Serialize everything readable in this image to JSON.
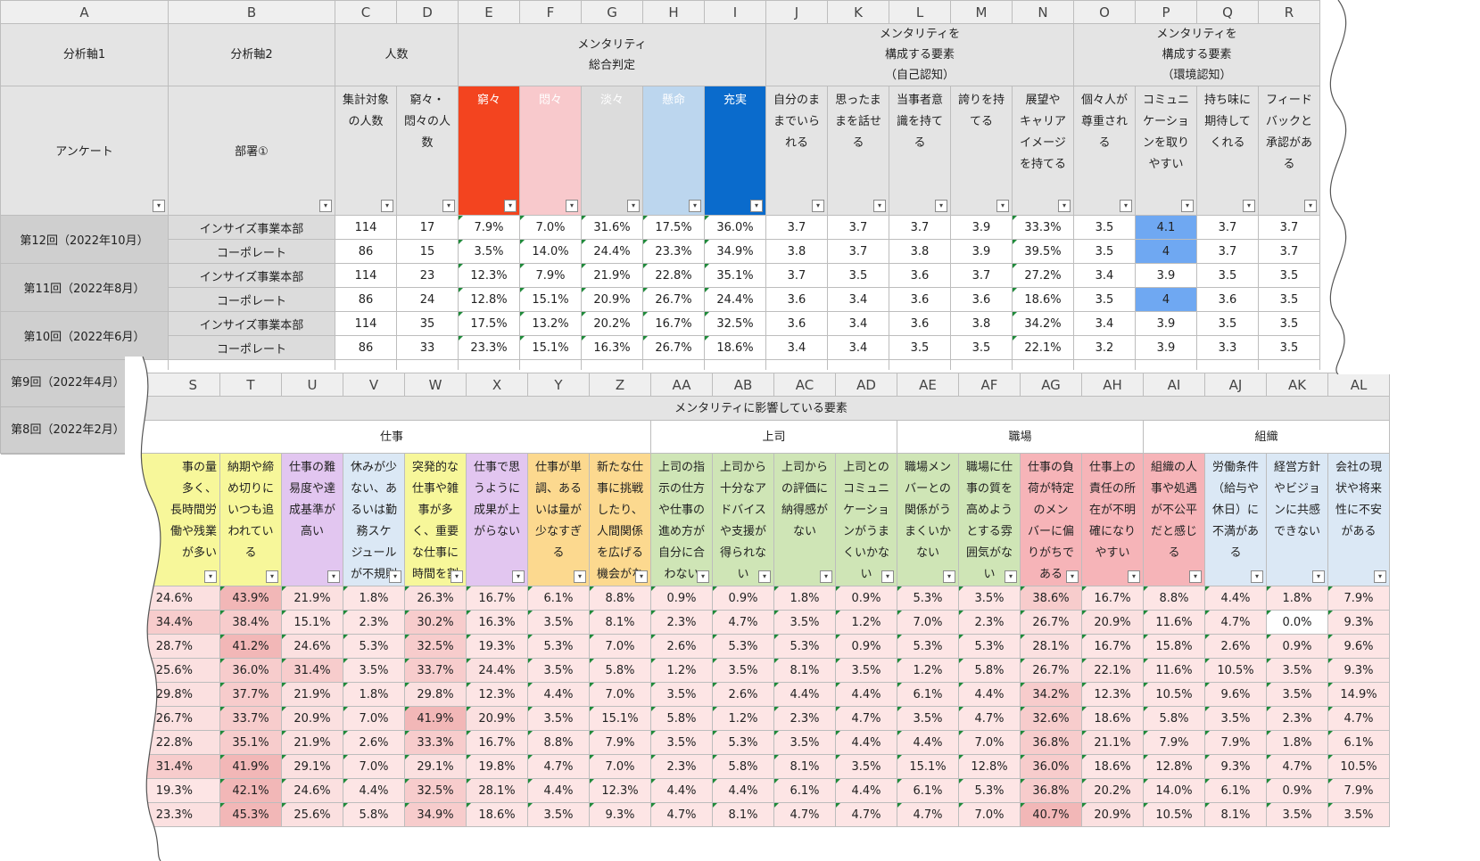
{
  "top": {
    "columns": [
      "A",
      "B",
      "C",
      "D",
      "E",
      "F",
      "G",
      "H",
      "I",
      "J",
      "K",
      "L",
      "M",
      "N",
      "O",
      "P",
      "Q",
      "R"
    ],
    "axis1_header": "分析軸1",
    "axis2_header": "分析軸2",
    "count_header": "人数",
    "mentality_header": "メンタリティ\n総合判定",
    "self_header": "メンタリティを\n構成する要素\n（自己認知）",
    "env_header": "メンタリティを\n構成する要素\n（環境認知）",
    "row_label_a": "アンケート",
    "row_label_b": "部署①",
    "questions": [
      {
        "text": "集計対象\nの人数",
        "bg": "#e4e4e4",
        "fg": "#222"
      },
      {
        "text": "窮々・\n悶々の人\n数",
        "bg": "#e4e4e4",
        "fg": "#222"
      },
      {
        "text": "窮々",
        "bg": "#f3441f",
        "fg": "#ffffff"
      },
      {
        "text": "悶々",
        "bg": "#f8c9cc",
        "fg": "#ffffff"
      },
      {
        "text": "淡々",
        "bg": "#dcdcdc",
        "fg": "#ffffff"
      },
      {
        "text": "懸命",
        "bg": "#bcd6ee",
        "fg": "#ffffff"
      },
      {
        "text": "充実",
        "bg": "#0a6bcc",
        "fg": "#ffffff"
      },
      {
        "text": "自分のま\nまでいら\nれる",
        "bg": "#e4e4e4",
        "fg": "#222"
      },
      {
        "text": "思ったま\nまを話せ\nる",
        "bg": "#e4e4e4",
        "fg": "#222"
      },
      {
        "text": "当事者意\n識を持て\nる",
        "bg": "#e4e4e4",
        "fg": "#222"
      },
      {
        "text": "誇りを持\nてる",
        "bg": "#e4e4e4",
        "fg": "#222"
      },
      {
        "text": "展望や\nキャリア\nイメージ\nを持てる",
        "bg": "#e4e4e4",
        "fg": "#222"
      },
      {
        "text": "個々人が\n尊重され\nる",
        "bg": "#e4e4e4",
        "fg": "#222"
      },
      {
        "text": "コミュニ\nケーショ\nンを取り\nやすい",
        "bg": "#e4e4e4",
        "fg": "#222"
      },
      {
        "text": "持ち味に\n期待して\nくれる",
        "bg": "#e4e4e4",
        "fg": "#222"
      },
      {
        "text": "フィード\nバックと\n承認があ\nる",
        "bg": "#e4e4e4",
        "fg": "#222"
      }
    ],
    "groups": [
      {
        "label": "第12回（2022年10月）",
        "rows": [
          {
            "dept": "インサイズ事業本部",
            "vals": [
              "114",
              "17",
              "7.9%",
              "7.0%",
              "31.6%",
              "17.5%",
              "36.0%",
              "3.7",
              "3.7",
              "3.7",
              "3.9",
              "33.3%",
              "3.5",
              "4.1",
              "3.7",
              "3.7"
            ]
          },
          {
            "dept": "コーポレート",
            "vals": [
              "86",
              "15",
              "3.5%",
              "14.0%",
              "24.4%",
              "23.3%",
              "34.9%",
              "3.8",
              "3.7",
              "3.8",
              "3.9",
              "39.5%",
              "3.5",
              "4",
              "3.7",
              "3.7"
            ]
          }
        ]
      },
      {
        "label": "第11回（2022年8月）",
        "rows": [
          {
            "dept": "インサイズ事業本部",
            "vals": [
              "114",
              "23",
              "12.3%",
              "7.9%",
              "21.9%",
              "22.8%",
              "35.1%",
              "3.7",
              "3.5",
              "3.6",
              "3.7",
              "27.2%",
              "3.4",
              "3.9",
              "3.5",
              "3.5"
            ]
          },
          {
            "dept": "コーポレート",
            "vals": [
              "86",
              "24",
              "12.8%",
              "15.1%",
              "20.9%",
              "26.7%",
              "24.4%",
              "3.6",
              "3.4",
              "3.6",
              "3.6",
              "18.6%",
              "3.5",
              "4",
              "3.6",
              "3.5"
            ]
          }
        ]
      },
      {
        "label": "第10回（2022年6月）",
        "rows": [
          {
            "dept": "インサイズ事業本部",
            "vals": [
              "114",
              "35",
              "17.5%",
              "13.2%",
              "20.2%",
              "16.7%",
              "32.5%",
              "3.6",
              "3.4",
              "3.6",
              "3.8",
              "34.2%",
              "3.4",
              "3.9",
              "3.5",
              "3.5"
            ]
          },
          {
            "dept": "コーポレート",
            "vals": [
              "86",
              "33",
              "23.3%",
              "15.1%",
              "16.3%",
              "26.7%",
              "18.6%",
              "3.4",
              "3.4",
              "3.5",
              "3.5",
              "22.1%",
              "3.2",
              "3.9",
              "3.3",
              "3.5"
            ]
          }
        ]
      }
    ],
    "behind_labels": [
      "第9回（2022年4月）",
      "第8回（2022年2月）"
    ]
  },
  "bottom": {
    "columns": [
      "S",
      "T",
      "U",
      "V",
      "W",
      "X",
      "Y",
      "Z",
      "AA",
      "AB",
      "AC",
      "AD",
      "AE",
      "AF",
      "AG",
      "AH",
      "AI",
      "AJ",
      "AK",
      "AL"
    ],
    "main_header": "メンタリティに影響している要素",
    "groups": [
      {
        "label": "仕事",
        "span": 8
      },
      {
        "label": "上司",
        "span": 4
      },
      {
        "label": "職場",
        "span": 4
      },
      {
        "label": "組織",
        "span": 4
      }
    ],
    "questions": [
      {
        "text": "事の量\n多く、\n長時間労\n働や残業\nが多い",
        "bg": "#f7f79a"
      },
      {
        "text": "納期や締\nめ切りに\nいつも追\nわれてい\nる",
        "bg": "#f7f79a"
      },
      {
        "text": "仕事の難\n易度や達\n成基準が\n高い",
        "bg": "#e2c6f0"
      },
      {
        "text": "休みが少\nない、あ\nるいは勤\n務スケ\nジュール\nが不規則",
        "bg": "#dbe8f5"
      },
      {
        "text": "突発的な\n仕事や雑\n事が多\nく、重要\nな仕事に\n時間を割",
        "bg": "#f7f79a"
      },
      {
        "text": "仕事で思\nうように\n成果が上\nがらない",
        "bg": "#e2c6f0"
      },
      {
        "text": "仕事が単\n調、ある\nいは量が\n少なすぎ\nる",
        "bg": "#fcd98f"
      },
      {
        "text": "新たな仕\n事に挑戦\nしたり、\n人間関係\nを広げる\n機会がな",
        "bg": "#fcd98f"
      },
      {
        "text": "上司の指\n示の仕方\nや仕事の\n進め方が\n自分に合\nわない",
        "bg": "#cfe5b6"
      },
      {
        "text": "上司から\n十分なア\nドバイス\nや支援が\n得られな\nい",
        "bg": "#cfe5b6"
      },
      {
        "text": "上司から\nの評価に\n納得感が\nない",
        "bg": "#cfe5b6"
      },
      {
        "text": "上司との\nコミュニ\nケーショ\nンがうま\nくいかな\nい",
        "bg": "#cfe5b6"
      },
      {
        "text": "職場メン\nバーとの\n関係がう\nまくいか\nない",
        "bg": "#cfe5b6"
      },
      {
        "text": "職場に仕\n事の質を\n高めよう\nとする雰\n囲気がな\nい",
        "bg": "#cfe5b6"
      },
      {
        "text": "仕事の負\n荷が特定\nのメン\nバーに偏\nりがちで\nある",
        "bg": "#f6b4b8"
      },
      {
        "text": "仕事上の\n責任の所\n在が不明\n確になり\nやすい",
        "bg": "#f6b4b8"
      },
      {
        "text": "組織の人\n事や処遇\nが不公平\nだと感じ\nる",
        "bg": "#f6b4b8"
      },
      {
        "text": "労働条件\n（給与や\n休日）に\n不満があ\nる",
        "bg": "#dbe8f5"
      },
      {
        "text": "経営方針\nやビジョ\nンに共感\nできない",
        "bg": "#dbe8f5"
      },
      {
        "text": "会社の現\n状や将来\n性に不安\nがある",
        "bg": "#dbe8f5"
      }
    ],
    "rows": [
      [
        "24.6%",
        "43.9%",
        "21.9%",
        "1.8%",
        "26.3%",
        "16.7%",
        "6.1%",
        "8.8%",
        "0.9%",
        "0.9%",
        "1.8%",
        "0.9%",
        "5.3%",
        "3.5%",
        "38.6%",
        "16.7%",
        "8.8%",
        "4.4%",
        "1.8%",
        "7.9%"
      ],
      [
        "34.4%",
        "38.4%",
        "15.1%",
        "2.3%",
        "30.2%",
        "16.3%",
        "3.5%",
        "8.1%",
        "2.3%",
        "4.7%",
        "3.5%",
        "1.2%",
        "7.0%",
        "2.3%",
        "26.7%",
        "20.9%",
        "11.6%",
        "4.7%",
        "0.0%",
        "9.3%"
      ],
      [
        "28.7%",
        "41.2%",
        "24.6%",
        "5.3%",
        "32.5%",
        "19.3%",
        "5.3%",
        "7.0%",
        "2.6%",
        "5.3%",
        "5.3%",
        "0.9%",
        "5.3%",
        "5.3%",
        "28.1%",
        "16.7%",
        "15.8%",
        "2.6%",
        "0.9%",
        "9.6%"
      ],
      [
        "25.6%",
        "36.0%",
        "31.4%",
        "3.5%",
        "33.7%",
        "24.4%",
        "3.5%",
        "5.8%",
        "1.2%",
        "3.5%",
        "8.1%",
        "3.5%",
        "1.2%",
        "5.8%",
        "26.7%",
        "22.1%",
        "11.6%",
        "10.5%",
        "3.5%",
        "9.3%"
      ],
      [
        "29.8%",
        "37.7%",
        "21.9%",
        "1.8%",
        "29.8%",
        "12.3%",
        "4.4%",
        "7.0%",
        "3.5%",
        "2.6%",
        "4.4%",
        "4.4%",
        "6.1%",
        "4.4%",
        "34.2%",
        "12.3%",
        "10.5%",
        "9.6%",
        "3.5%",
        "14.9%"
      ],
      [
        "26.7%",
        "33.7%",
        "20.9%",
        "7.0%",
        "41.9%",
        "20.9%",
        "3.5%",
        "15.1%",
        "5.8%",
        "1.2%",
        "2.3%",
        "4.7%",
        "3.5%",
        "4.7%",
        "32.6%",
        "18.6%",
        "5.8%",
        "3.5%",
        "2.3%",
        "4.7%"
      ],
      [
        "22.8%",
        "35.1%",
        "21.9%",
        "2.6%",
        "33.3%",
        "16.7%",
        "8.8%",
        "7.9%",
        "3.5%",
        "5.3%",
        "3.5%",
        "4.4%",
        "4.4%",
        "7.0%",
        "36.8%",
        "21.1%",
        "7.9%",
        "7.9%",
        "1.8%",
        "6.1%"
      ],
      [
        "31.4%",
        "41.9%",
        "29.1%",
        "7.0%",
        "29.1%",
        "19.8%",
        "4.7%",
        "7.0%",
        "2.3%",
        "5.8%",
        "8.1%",
        "3.5%",
        "15.1%",
        "12.8%",
        "36.0%",
        "18.6%",
        "12.8%",
        "9.3%",
        "4.7%",
        "10.5%"
      ],
      [
        "19.3%",
        "42.1%",
        "24.6%",
        "4.4%",
        "32.5%",
        "28.1%",
        "4.4%",
        "12.3%",
        "4.4%",
        "4.4%",
        "6.1%",
        "4.4%",
        "6.1%",
        "5.3%",
        "36.8%",
        "20.2%",
        "14.0%",
        "6.1%",
        "0.9%",
        "7.9%"
      ],
      [
        "23.3%",
        "45.3%",
        "25.6%",
        "5.8%",
        "34.9%",
        "18.6%",
        "3.5%",
        "9.3%",
        "4.7%",
        "8.1%",
        "4.7%",
        "4.7%",
        "4.7%",
        "7.0%",
        "40.7%",
        "20.9%",
        "10.5%",
        "8.1%",
        "3.5%",
        "3.5%"
      ]
    ]
  }
}
